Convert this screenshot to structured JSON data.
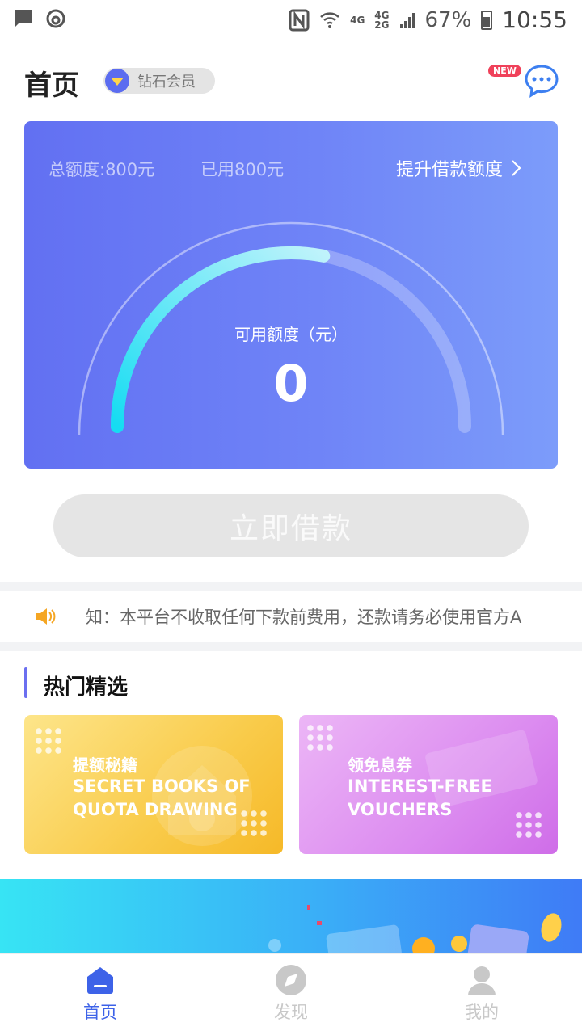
{
  "status_bar": {
    "battery": "67%",
    "time": "10:55",
    "net_a": "4G",
    "net_b": "4G",
    "net_c": "2G"
  },
  "header": {
    "title": "首页",
    "member_label": "钻石会员",
    "new_badge": "NEW"
  },
  "credit": {
    "total_limit": "总额度:800元",
    "used": "已用800元",
    "raise_link": "提升借款额度",
    "available_label": "可用额度（元）",
    "available_value": "0",
    "gauge_fill": 0.56
  },
  "borrow_button": "立即借款",
  "notice": {
    "text": "知：本平台不收取任何下款前费用，还款请务必使用官方A"
  },
  "featured": {
    "title": "热门精选",
    "cards": [
      {
        "cn": "提额秘籍",
        "en": "SECRET BOOKS OF QUOTA DRAWING"
      },
      {
        "cn": "领免息券",
        "en": "INTEREST-FREE VOUCHERS"
      }
    ]
  },
  "tabs": [
    {
      "label": "首页",
      "active": true
    },
    {
      "label": "发现",
      "active": false
    },
    {
      "label": "我的",
      "active": false
    }
  ],
  "colors": {
    "accent": "#5b6cf0",
    "tab_active": "#3d62e8",
    "tab_inactive": "#c8c8c8"
  }
}
